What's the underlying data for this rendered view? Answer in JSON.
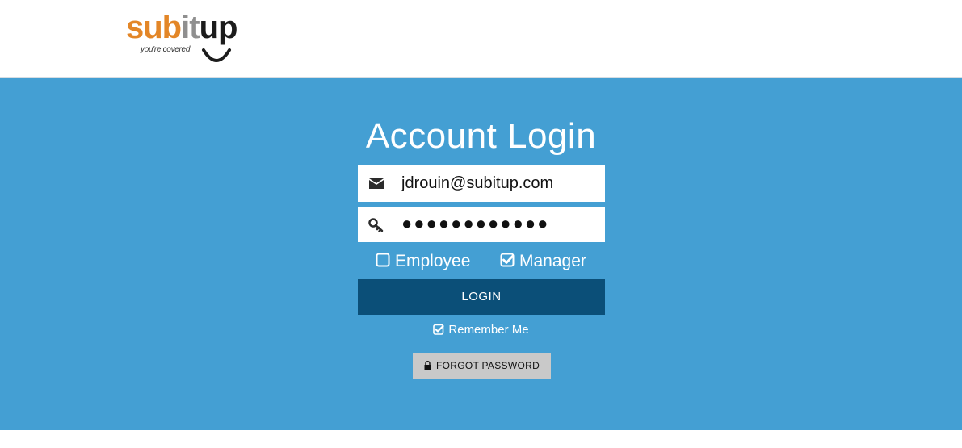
{
  "brand": {
    "logo_part1": "s",
    "logo_part2": "ub",
    "logo_part3": "i",
    "logo_part4": "t",
    "logo_part5": "up",
    "tagline": "you're covered",
    "colors": {
      "orange": "#e38627",
      "gray": "#8f8f8f",
      "dark": "#1c1c1c"
    }
  },
  "page": {
    "title": "Account Login",
    "background": "#449fd3"
  },
  "form": {
    "email": {
      "value": "jdrouin@subitup.com",
      "icon": "envelope-icon"
    },
    "password": {
      "value": "●●●●●●●●●●●●",
      "icon": "key-icon"
    },
    "roles": {
      "employee": {
        "label": "Employee",
        "checked": false
      },
      "manager": {
        "label": "Manager",
        "checked": true
      }
    },
    "login_label": "LOGIN",
    "login_color": "#0b4f78",
    "remember_label": "Remember Me",
    "remember_checked": true,
    "forgot_label": "FORGOT PASSWORD"
  }
}
